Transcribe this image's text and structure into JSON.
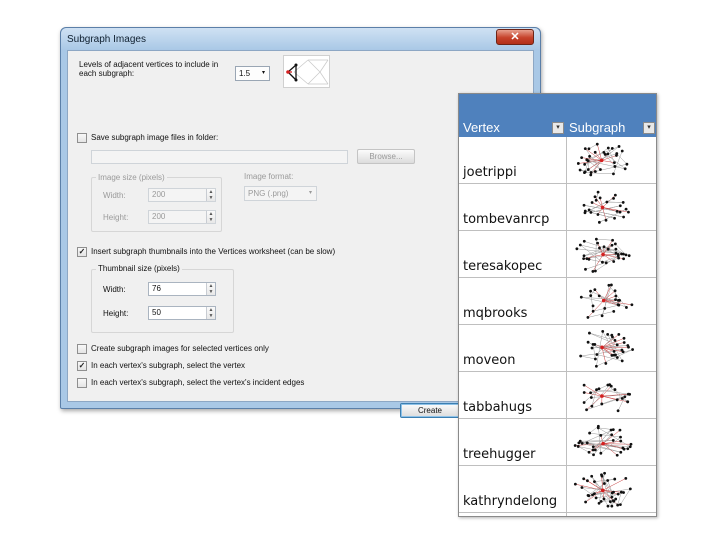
{
  "dialog": {
    "title": "Subgraph Images",
    "close_glyph": "✕",
    "levels_label_line1": "Levels of adjacent vertices to include in",
    "levels_label_line2": "each subgraph:",
    "levels_value": "1.5",
    "save_files_label": "Save subgraph image files in folder:",
    "save_files_checked": false,
    "folder_path": "",
    "browse_label": "Browse...",
    "image_size_group": "Image size (pixels)",
    "image_width_label": "Width:",
    "image_width_value": "200",
    "image_height_label": "Height:",
    "image_height_value": "200",
    "image_format_label": "Image format:",
    "image_format_value": "PNG (.png)",
    "insert_thumbnails_label": "Insert subgraph thumbnails into the Vertices worksheet (can be slow)",
    "insert_thumbnails_checked": true,
    "thumb_size_group": "Thumbnail size (pixels)",
    "thumb_width_label": "Width:",
    "thumb_width_value": "76",
    "thumb_height_label": "Height:",
    "thumb_height_value": "50",
    "selected_only_label": "Create subgraph images for selected vertices only",
    "selected_only_checked": false,
    "select_vertex_label": "In each vertex's subgraph, select the vertex",
    "select_vertex_checked": true,
    "select_edges_label": "In each vertex's subgraph, select the vertex's incident edges",
    "select_edges_checked": false,
    "create_label": "Create",
    "check_glyph": "✓",
    "dropdown_glyph": "▾",
    "spin_up_glyph": "▲",
    "spin_down_glyph": "▼"
  },
  "worksheet": {
    "columns": [
      "Vertex",
      "Subgraph"
    ],
    "filter_glyph": "▾",
    "rows": [
      {
        "vertex": "joetrippi"
      },
      {
        "vertex": "tombevanrcp"
      },
      {
        "vertex": "teresakopec"
      },
      {
        "vertex": "mqbrooks"
      },
      {
        "vertex": "moveon"
      },
      {
        "vertex": "tabbahugs"
      },
      {
        "vertex": "treehugger"
      },
      {
        "vertex": "kathryndelong"
      }
    ]
  },
  "colors": {
    "header_blue": "#4f81bd",
    "selected_vertex_red": "#d42020",
    "close_red": "#c6422b"
  }
}
